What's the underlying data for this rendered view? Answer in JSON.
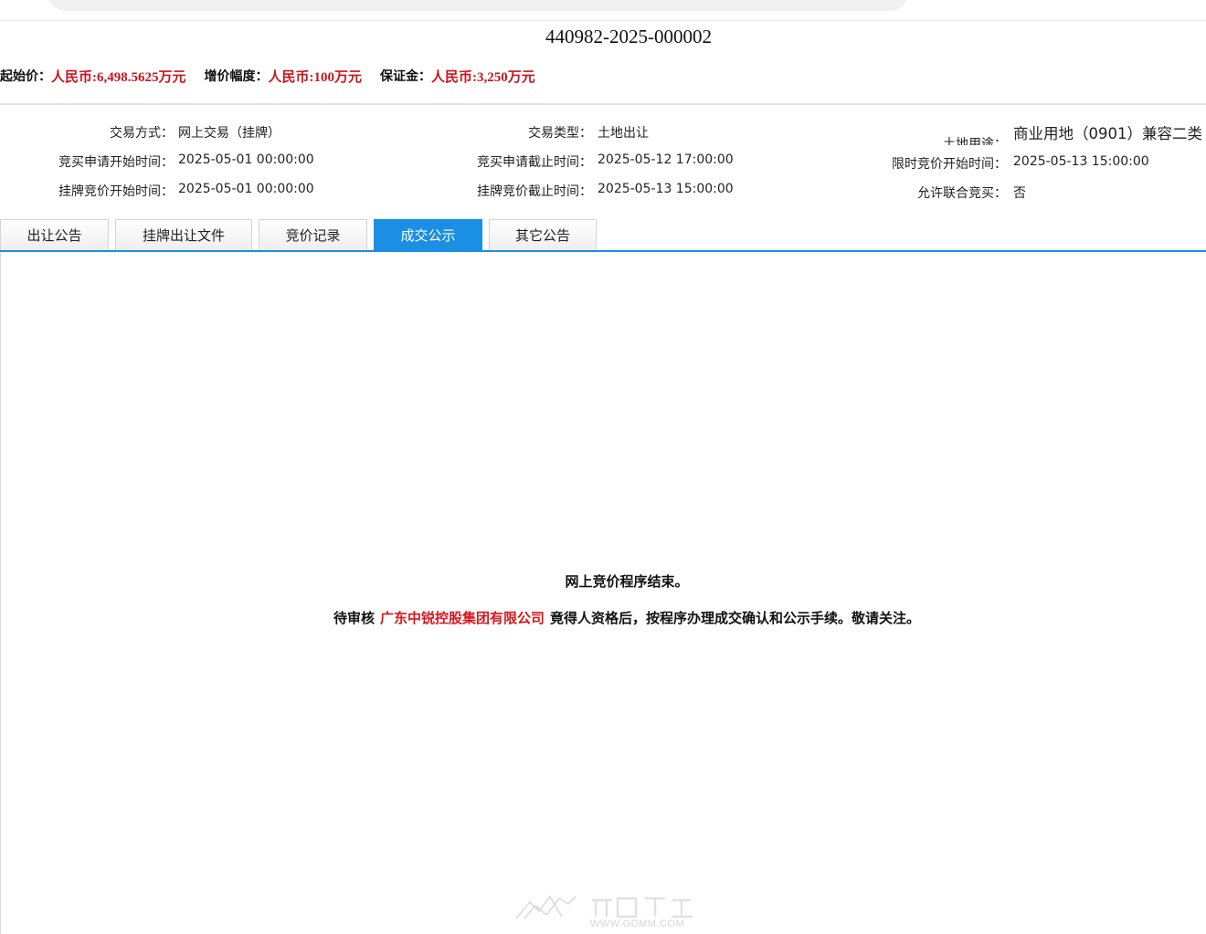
{
  "listing": {
    "code": "440982-2025-000002"
  },
  "prices": {
    "start_price_label": "起始价：",
    "start_price_value": "人民币:6,498.5625万元",
    "increment_label": "增价幅度：",
    "increment_value": "人民币:100万元",
    "deposit_label": "保证金：",
    "deposit_value": "人民币:3,250万元"
  },
  "info": {
    "trade_method_label": "交易方式：",
    "trade_method_value": "网上交易（挂牌）",
    "trade_type_label": "交易类型：",
    "trade_type_value": "土地出让",
    "land_use_label": "土地用途：",
    "land_use_value": "商业用地（0901）兼容二类",
    "apply_start_label": "竞买申请开始时间：",
    "apply_start_value": "2025-05-01 00:00:00",
    "apply_end_label": "竞买申请截止时间：",
    "apply_end_value": "2025-05-12 17:00:00",
    "timed_bid_start_label": "限时竞价开始时间：",
    "timed_bid_start_value": "2025-05-13 15:00:00",
    "listing_bid_start_label": "挂牌竞价开始时间：",
    "listing_bid_start_value": "2025-05-01 00:00:00",
    "listing_bid_end_label": "挂牌竞价截止时间：",
    "listing_bid_end_value": "2025-05-13 15:00:00",
    "joint_bid_label": "允许联合竞买：",
    "joint_bid_value": "否"
  },
  "tabs": [
    {
      "label": "出让公告"
    },
    {
      "label": "挂牌出让文件"
    },
    {
      "label": "竞价记录"
    },
    {
      "label": "成交公示"
    },
    {
      "label": "其它公告"
    }
  ],
  "result": {
    "line1": "网上竞价程序结束。",
    "line2_prefix": "待审核",
    "winner": "广东中锐控股集团有限公司",
    "line2_suffix": "竟得人资格后，按程序办理成交确认和公示手续。敬请关注。"
  },
  "watermark": {
    "url": "WWW.GDMM.COM",
    "logo_icon": "gdmm-logo-icon"
  },
  "colors": {
    "accent": "#1a8fe3",
    "price_red": "#c8161d",
    "winner_red": "#d9161d"
  }
}
